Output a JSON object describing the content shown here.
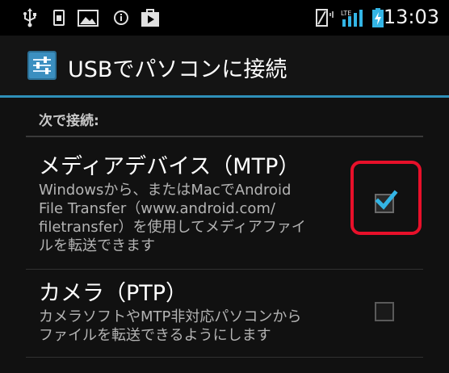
{
  "status_bar": {
    "time": "13:03",
    "icons": [
      "usb-icon",
      "sim-icon",
      "picture-icon",
      "info-icon",
      "shopping-bag-icon",
      "vibrate-icon",
      "lte-signal-icon",
      "battery-charging-icon"
    ]
  },
  "action_bar": {
    "title": "USBでパソコンに接続",
    "icon": "settings-icon"
  },
  "section": {
    "header": "次で接続:"
  },
  "options": [
    {
      "title": "メディアデバイス（MTP）",
      "summary_lines": [
        "Windowsから、またはMacでAndroid",
        "File Transfer（www.android.com/",
        "filetransfer）を使用してメディアファイ",
        "ルを転送できます"
      ],
      "checked": true
    },
    {
      "title": "カメラ（PTP）",
      "summary_lines": [
        "カメラソフトやMTP非対応パソコンから",
        "ファイルを転送できるようにします"
      ],
      "checked": false
    }
  ],
  "colors": {
    "accent": "#33b5e5",
    "highlight": "#e8102a",
    "divider": "#2e90b9"
  }
}
